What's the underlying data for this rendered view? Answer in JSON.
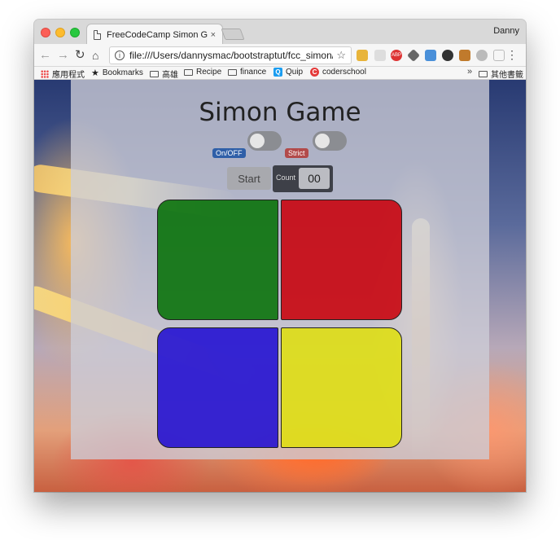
{
  "browser": {
    "tab_title": "FreeCodeCamp Simon Game",
    "tab_close": "×",
    "profile_name": "Danny",
    "url": "file:///Users/dannysmac/bootstraptut/fcc_simon/i...",
    "nav": {
      "back": "←",
      "forward": "→",
      "reload": "↻",
      "home": "⌂",
      "star": "☆",
      "info": "i",
      "menu": "⋮"
    }
  },
  "bookmarks": {
    "items": [
      {
        "label": "應用程式",
        "icon": "apps-grid-icon"
      },
      {
        "label": "Bookmarks",
        "icon": "star-icon"
      },
      {
        "label": "高雄",
        "icon": "folder-icon"
      },
      {
        "label": "Recipe",
        "icon": "folder-icon"
      },
      {
        "label": "finance",
        "icon": "folder-icon"
      },
      {
        "label": "Quip",
        "icon": "quip-icon"
      },
      {
        "label": "coderschool",
        "icon": "coderschool-icon"
      }
    ],
    "overflow": "»",
    "other": "其他書籤"
  },
  "extensions": {
    "abp_label": "ABP",
    "colors": [
      "#e8b43a",
      "#d33",
      "#666",
      "#4a90d9",
      "#333",
      "#c07a2c",
      "#999",
      "#bbb"
    ]
  },
  "game": {
    "title": "Simon Game",
    "onoff_label": "On/OFF",
    "strict_label": "Strict",
    "start_label": "Start",
    "count_label": "Count",
    "count_value": "00"
  },
  "colors": {
    "green_pad": "#006e00",
    "red_pad": "#c8000a",
    "blue_pad": "#1400d2",
    "yellow_pad": "#e1e100",
    "onoff_badge": "#2f5fa8",
    "strict_badge": "#b24a4a"
  }
}
